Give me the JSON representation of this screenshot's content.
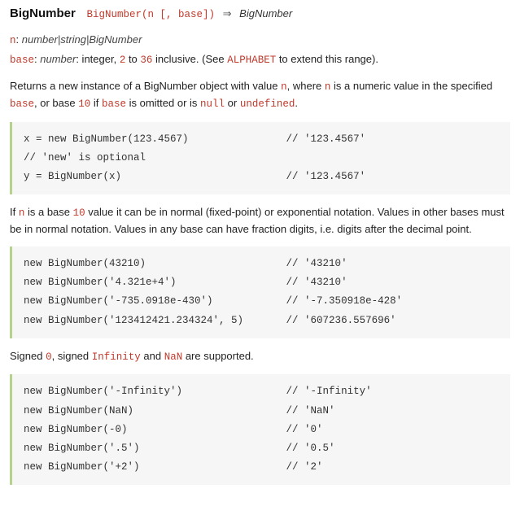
{
  "header": {
    "title": "BigNumber",
    "signature": "BigNumber(n [, base])",
    "arrow": "⇒",
    "returns": "BigNumber"
  },
  "params": {
    "n": {
      "name": "n",
      "type": "number|string|BigNumber"
    },
    "base": {
      "name": "base",
      "type": "number",
      "desc1": ": integer, ",
      "low": "2",
      "to": " to ",
      "high": "36",
      "desc2": " inclusive. (See ",
      "alphabet": "ALPHABET",
      "desc3": " to extend this range)."
    }
  },
  "desc1": {
    "t1": "Returns a new instance of a BigNumber object with value ",
    "n": "n",
    "t2": ", where ",
    "n2": "n",
    "t3": " is a numeric value in the specified ",
    "base": "base",
    "t4": ", or base ",
    "ten": "10",
    "t5": " if ",
    "base2": "base",
    "t6": " is omitted or is ",
    "null": "null",
    "t7": " or ",
    "undef": "undefined",
    "t8": "."
  },
  "code1": "x = new BigNumber(123.4567)                // '123.4567'\n// 'new' is optional\ny = BigNumber(x)                           // '123.4567'",
  "desc2": {
    "t1": "If ",
    "n": "n",
    "t2": " is a base ",
    "ten": "10",
    "t3": " value it can be in normal (fixed-point) or exponential notation. Values in other bases must be in normal notation. Values in any base can have fraction digits, i.e. digits after the decimal point."
  },
  "code2": "new BigNumber(43210)                       // '43210'\nnew BigNumber('4.321e+4')                  // '43210'\nnew BigNumber('-735.0918e-430')            // '-7.350918e-428'\nnew BigNumber('123412421.234324', 5)       // '607236.557696'",
  "desc3": {
    "t1": "Signed ",
    "zero": "0",
    "t2": ", signed ",
    "inf": "Infinity",
    "t3": " and ",
    "nan": "NaN",
    "t4": " are supported."
  },
  "code3": "new BigNumber('-Infinity')                 // '-Infinity'\nnew BigNumber(NaN)                         // 'NaN'\nnew BigNumber(-0)                          // '0'\nnew BigNumber('.5')                        // '0.5'\nnew BigNumber('+2')                        // '2'"
}
